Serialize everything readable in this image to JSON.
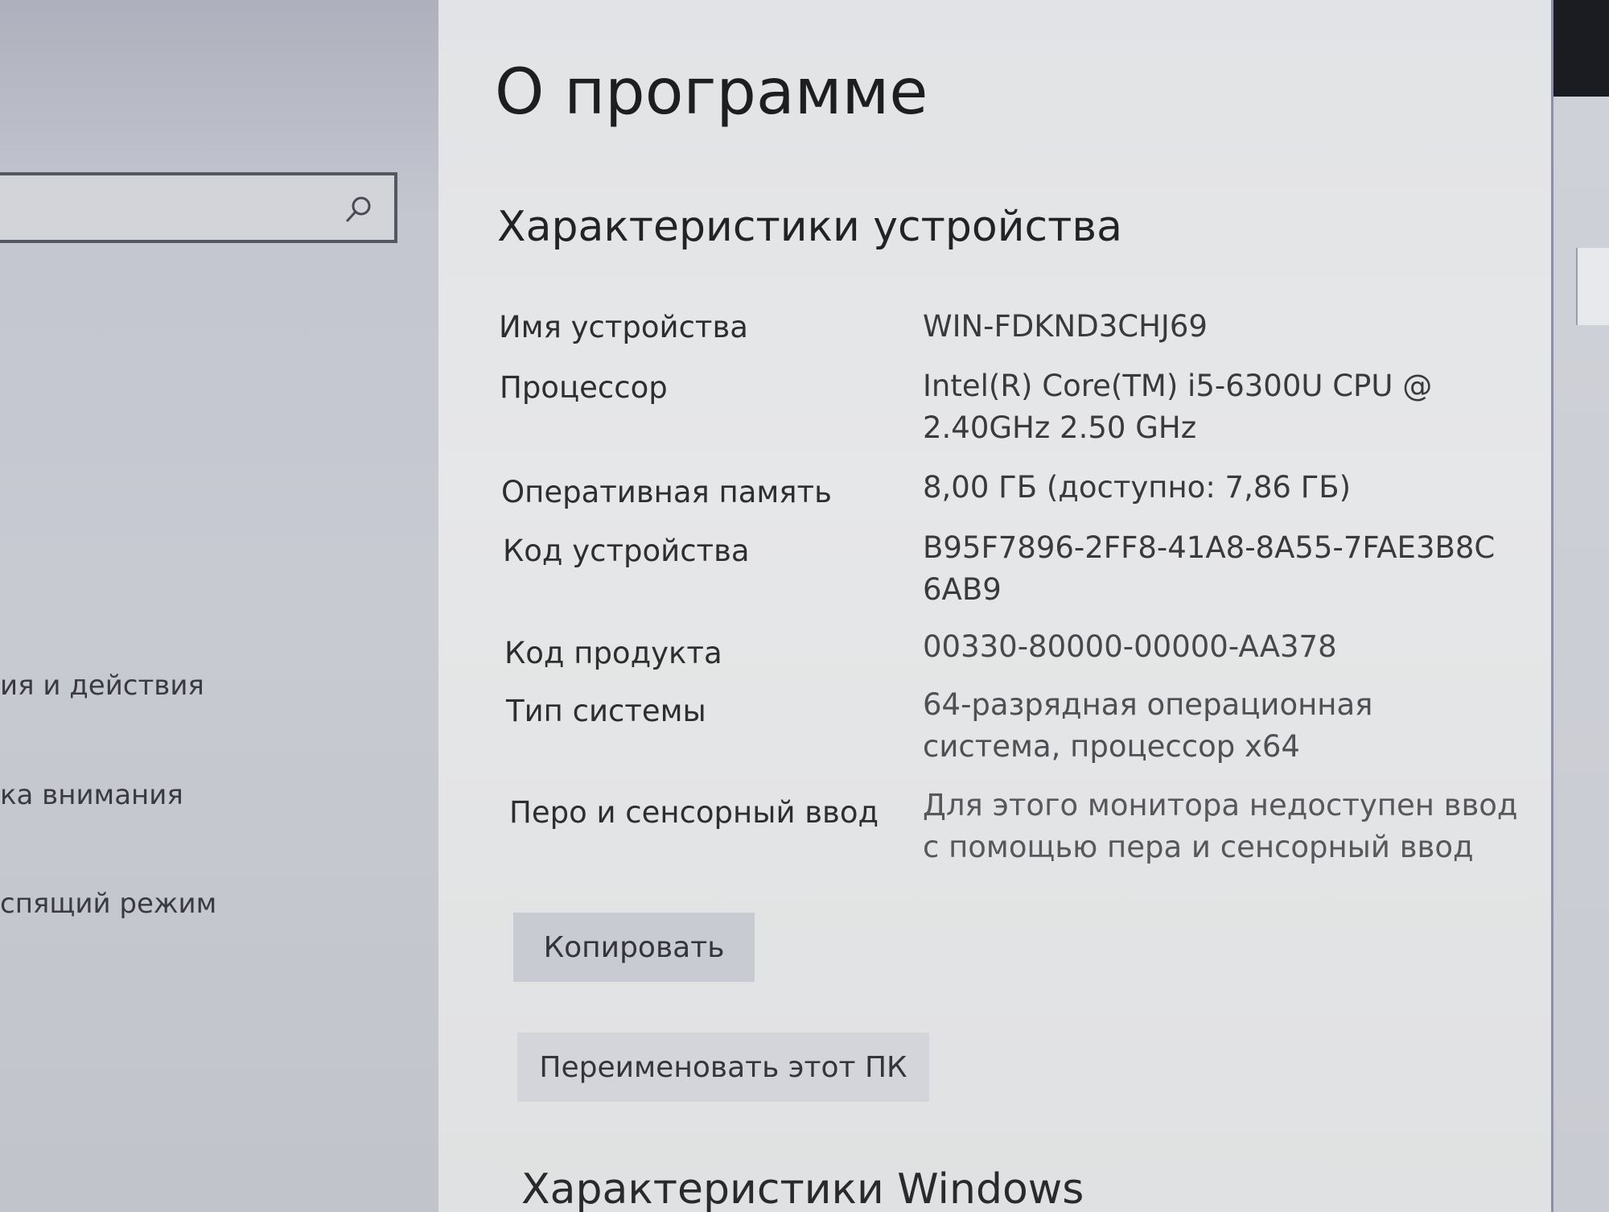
{
  "window": {
    "page_title": "О программе",
    "section_title": "Характеристики устройства",
    "section_title_2": "Характеристики Windows"
  },
  "sidebar": {
    "search": {
      "value": "",
      "icon": "search-icon"
    },
    "items": [
      {
        "label": "ия и действия"
      },
      {
        "label": "ка внимания"
      },
      {
        "label": "спящий режим"
      }
    ]
  },
  "specs": {
    "device_name": {
      "label": "Имя устройства",
      "value": "WIN-FDKND3CHJ69"
    },
    "processor": {
      "label": "Процессор",
      "value": "Intel(R) Core(TM) i5-6300U CPU @ 2.40GHz   2.50 GHz"
    },
    "ram": {
      "label": "Оперативная память",
      "value": "8,00 ГБ (доступно: 7,86 ГБ)"
    },
    "device_id": {
      "label": "Код устройства",
      "value": "B95F7896-2FF8-41A8-8A55-7FAE3B8C6AB9"
    },
    "product_id": {
      "label": "Код продукта",
      "value": "00330-80000-00000-AA378"
    },
    "system_type": {
      "label": "Тип системы",
      "value": "64-разрядная операционная система, процессор x64"
    },
    "pen_touch": {
      "label": "Перо и сенсорный ввод",
      "value": "Для этого монитора недоступен ввод с помощью пера и сенсорный ввод"
    }
  },
  "buttons": {
    "copy_label": "Копировать",
    "rename_label": "Переименовать этот ПК"
  },
  "colors": {
    "main_background": "#e4e5e7",
    "sidebar_background": "#c4c6d0",
    "button_background": "#c9cbd2"
  }
}
